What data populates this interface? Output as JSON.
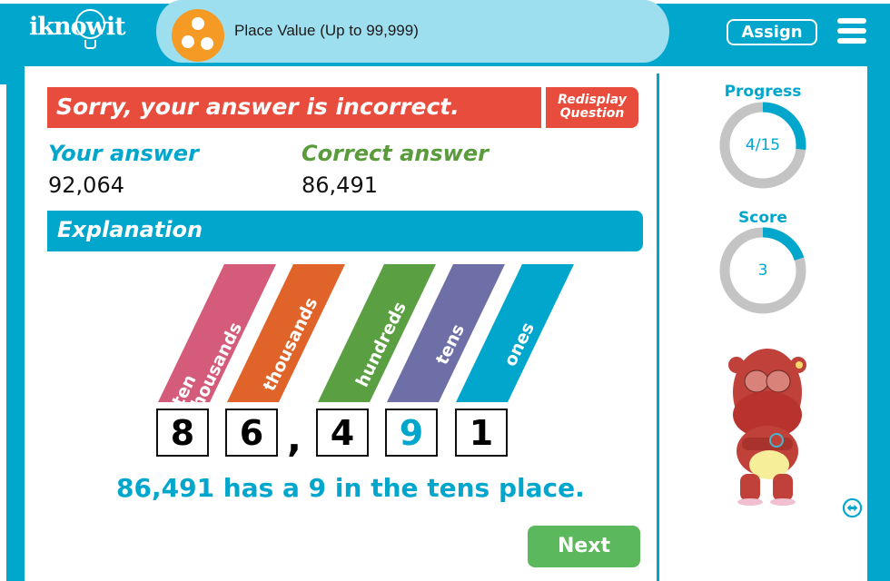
{
  "header": {
    "logo": "iknowit",
    "topic_title": "Place Value (Up to 99,999)",
    "topic_icon": "three-dots-icon",
    "assign_label": "Assign",
    "menu_icon": "hamburger-menu-icon"
  },
  "feedback": {
    "message": "Sorry, your answer is incorrect.",
    "redisplay_label_line1": "Redisplay",
    "redisplay_label_line2": "Question",
    "your_answer_label": "Your answer",
    "your_answer_value": "92,064",
    "correct_answer_label": "Correct answer",
    "correct_answer_value": "86,491"
  },
  "explanation": {
    "title": "Explanation",
    "places": [
      {
        "label_line1": "ten",
        "label_line2": "thousands",
        "digit": "8",
        "color": "#d45b7a",
        "highlight": false
      },
      {
        "label_line1": "thousands",
        "label_line2": "",
        "digit": "6",
        "color": "#e06329",
        "highlight": false
      },
      {
        "label_line1": "hundreds",
        "label_line2": "",
        "digit": "4",
        "color": "#5aa043",
        "highlight": false
      },
      {
        "label_line1": "tens",
        "label_line2": "",
        "digit": "9",
        "color": "#6f6fa8",
        "highlight": true
      },
      {
        "label_line1": "ones",
        "label_line2": "",
        "digit": "1",
        "color": "#00a6cc",
        "highlight": false
      }
    ],
    "separator": ",",
    "summary": "86,491 has a 9 in the tens place.",
    "highlight_color": "#00a6cc"
  },
  "actions": {
    "next_label": "Next"
  },
  "sidebar": {
    "progress_label": "Progress",
    "progress_text": "4/15",
    "progress_fraction": 0.2667,
    "score_label": "Score",
    "score_text": "3",
    "score_fraction": 0.2,
    "expand_icon": "double-arrow-icon"
  },
  "colors": {
    "brand_blue": "#00a6cc",
    "tab_light_blue": "#9edfef",
    "error_red": "#e84c3d",
    "success_green": "#5cb85c",
    "correct_green": "#5a9b3c",
    "ring_grey": "#c4c4c4"
  }
}
